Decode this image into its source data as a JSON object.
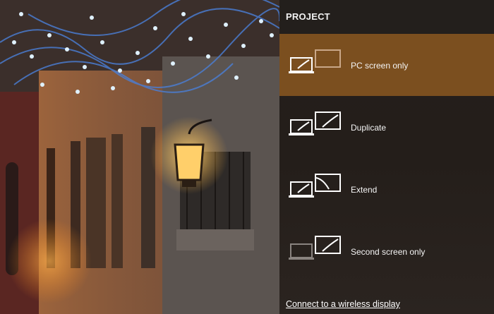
{
  "project_panel": {
    "title": "PROJECT",
    "options": [
      {
        "label": "PC screen only",
        "icon": "pc-screen-only-icon",
        "selected": true
      },
      {
        "label": "Duplicate",
        "icon": "duplicate-icon",
        "selected": false
      },
      {
        "label": "Extend",
        "icon": "extend-icon",
        "selected": false
      },
      {
        "label": "Second screen only",
        "icon": "second-screen-only-icon",
        "selected": false
      }
    ],
    "connect_link": "Connect to a wireless display"
  },
  "colors": {
    "selected_background": "#7b4f1f",
    "panel_background": "#231f1c",
    "text": "#ffffff"
  }
}
